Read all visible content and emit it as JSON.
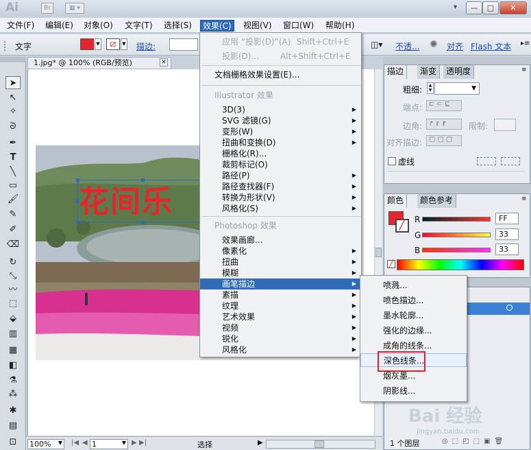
{
  "app": {
    "logo": "Ai",
    "bridge_label": "Br",
    "close_glyph": "✕",
    "min_glyph": "—",
    "max_glyph": "□"
  },
  "menubar": [
    {
      "label": "文件(F)"
    },
    {
      "label": "编辑(E)"
    },
    {
      "label": "对象(O)"
    },
    {
      "label": "文字(T)"
    },
    {
      "label": "选择(S)"
    },
    {
      "label": "效果(C)"
    },
    {
      "label": "视图(V)"
    },
    {
      "label": "窗口(W)"
    },
    {
      "label": "帮助(H)"
    }
  ],
  "control_bar": {
    "type_label": "文字",
    "stroke_label": "描边:",
    "opacity_link": "不透...",
    "align_link": "对齐",
    "flash_link": "Flash 文本"
  },
  "document": {
    "tab_title": "1.jpg* @ 100% (RGB/预览)",
    "art_text": "花间乐"
  },
  "status_bar": {
    "zoom": "100%",
    "page": "1",
    "tool": "选择"
  },
  "stroke_panel": {
    "tabs": [
      "描边",
      "渐变",
      "透明度"
    ],
    "weight_label": "粗细:",
    "cap_label": "端点:",
    "corner_label": "边角:",
    "limit_label": "限制:",
    "align_label": "对齐描边:",
    "dashed_label": "虚线"
  },
  "color_panel": {
    "tabs": [
      "颜色",
      "颜色参考"
    ],
    "channels": [
      {
        "name": "R",
        "value": "FF"
      },
      {
        "name": "G",
        "value": "33"
      },
      {
        "name": "B",
        "value": "33"
      }
    ],
    "fill_color": "#e8252f"
  },
  "layers_panel": {
    "footer": "1 个图层"
  },
  "effect_menu": {
    "items": [
      {
        "label": "应用 “投影(D)”(A)",
        "shortcut": "Shift+Ctrl+E",
        "disabled": true
      },
      {
        "label": "投影(D)...",
        "shortcut": "Alt+Shift+Ctrl+E",
        "disabled": true
      },
      {
        "label": "文档栅格效果设置(E)..."
      }
    ],
    "illustrator_header": "Illustrator 效果",
    "illustrator_items": [
      {
        "label": "3D(3)"
      },
      {
        "label": "SVG 滤镜(G)"
      },
      {
        "label": "变形(W)"
      },
      {
        "label": "扭曲和变换(D)"
      },
      {
        "label": "栅格化(R)..."
      },
      {
        "label": "裁剪标记(O)"
      },
      {
        "label": "路径(P)"
      },
      {
        "label": "路径查找器(F)"
      },
      {
        "label": "转换为形状(V)"
      },
      {
        "label": "风格化(S)"
      }
    ],
    "photoshop_header": "Photoshop 效果",
    "photoshop_items": [
      {
        "label": "效果画廊..."
      },
      {
        "label": "像素化"
      },
      {
        "label": "扭曲"
      },
      {
        "label": "模糊"
      },
      {
        "label": "画笔描边"
      },
      {
        "label": "素描"
      },
      {
        "label": "纹理"
      },
      {
        "label": "艺术效果"
      },
      {
        "label": "视频"
      },
      {
        "label": "锐化"
      },
      {
        "label": "风格化"
      }
    ]
  },
  "brush_stroke_submenu": [
    {
      "label": "喷溅..."
    },
    {
      "label": "喷色描边..."
    },
    {
      "label": "墨水轮廓..."
    },
    {
      "label": "强化的边缘..."
    },
    {
      "label": "成角的线条..."
    },
    {
      "label": "深色线条..."
    },
    {
      "label": "烟灰墨..."
    },
    {
      "label": "阴影线..."
    }
  ],
  "watermark": {
    "brand": "Bai 经验",
    "url": "jingyan.baidu.com"
  }
}
